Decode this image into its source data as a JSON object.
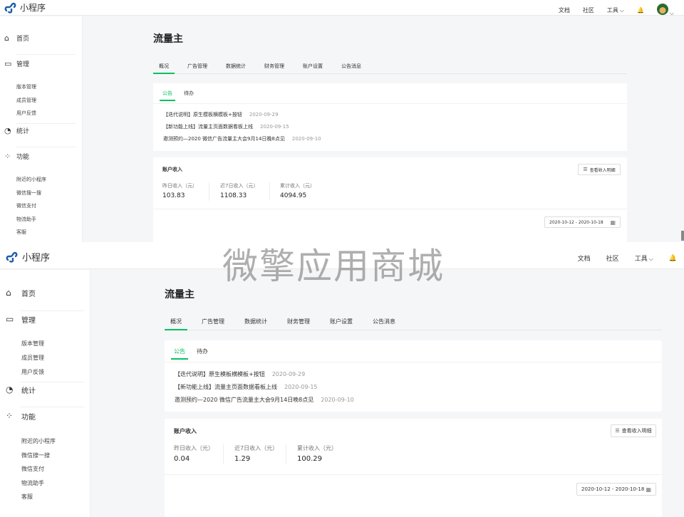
{
  "app": {
    "name": "小程序",
    "brand_color": "#1f5ea8",
    "accent_color": "#07c160"
  },
  "topnav": {
    "docs": "文档",
    "community": "社区",
    "tools": "工具"
  },
  "sidebar": {
    "home": "首页",
    "manage": "管理",
    "manage_items": [
      "版本管理",
      "成员管理",
      "用户反馈"
    ],
    "stats": "统计",
    "features": "功能",
    "feature_items": [
      "附近的小程序",
      "微信搜一搜",
      "微信支付",
      "物流助手",
      "客服"
    ]
  },
  "page": {
    "title": "流量主",
    "tabs": [
      "概况",
      "广告管理",
      "数据统计",
      "财务管理",
      "账户设置",
      "公告消息"
    ]
  },
  "notices": {
    "tabs": [
      "公告",
      "待办"
    ],
    "items": [
      {
        "text": "【迭代说明】原生模板横模板+按钮",
        "date": "2020-09-29"
      },
      {
        "text": "【新功能上线】流量主页面数据看板上线",
        "date": "2020-09-15"
      },
      {
        "text": "邀测预约—2020 微信广告流量主大会9月14日晚8点见",
        "date": "2020-09-10"
      }
    ]
  },
  "account": {
    "title": "账户收入",
    "detail_button": "查看收入明细",
    "labels": [
      "昨日收入（元）",
      "近7日收入（元）",
      "累计收入（元）"
    ],
    "values_top": [
      "103.83",
      "1108.33",
      "4094.95"
    ],
    "values_bottom": [
      "0.04",
      "1.29",
      "100.29"
    ],
    "date_range": "2020-10-12 - 2020-10-18"
  },
  "watermark": "微擎应用商城"
}
